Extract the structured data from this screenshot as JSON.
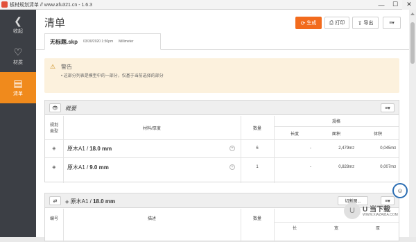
{
  "window": {
    "title": "板材规划清单 // www.afu321.cn - 1.6.3",
    "controls": {
      "minimize": "—",
      "maximize": "☐",
      "close": "✕"
    }
  },
  "sidebar": {
    "items": [
      {
        "label": "收起",
        "icon": "chevron-left-icon",
        "glyph": "❮"
      },
      {
        "label": "材质",
        "icon": "paint-icon",
        "glyph": "♡"
      },
      {
        "label": "清单",
        "icon": "list-icon",
        "glyph": "▤"
      }
    ]
  },
  "header": {
    "title": "清单",
    "buttons": {
      "generate": {
        "label": "生成",
        "glyph": "⟳"
      },
      "print": {
        "label": "打印",
        "glyph": "⎙"
      },
      "export": {
        "label": "导出",
        "glyph": "⇪"
      },
      "menu": {
        "glyph": "≡▾"
      }
    }
  },
  "file": {
    "name": "无标题.skp",
    "date": "03/30/2020 1:50pm",
    "unit": "Millimeter"
  },
  "warning": {
    "title": "警告",
    "text": "• 这部分列表是模型中的一部分，仅基于当前选择的部分"
  },
  "overview": {
    "title": "概要",
    "menu_glyph": "≡▾",
    "columns": {
      "type": "规划\n类型",
      "material": "材料/厚度",
      "qty": "数量",
      "spec": "规格",
      "length": "长度",
      "area": "面积",
      "volume": "体积"
    },
    "rows": [
      {
        "name": "原木A1 / ",
        "thick": "18.0 mm",
        "qty": "6",
        "length": "-",
        "area": "2,479m",
        "volume": "0,045m"
      },
      {
        "name": "原木A1 / ",
        "thick": "9.0 mm",
        "qty": "1",
        "length": "-",
        "area": "0,828m",
        "volume": "0,007m"
      }
    ],
    "area_sup": "2",
    "volume_sup": "3"
  },
  "section2": {
    "title_prefix": "原木A1 / ",
    "title_thick": "18.0 mm",
    "cut_label": "切割图...",
    "columns": {
      "id": "编号",
      "desc": "描述",
      "qty": "数量",
      "length": "长",
      "width": "宽",
      "thick": "厚"
    }
  },
  "watermark": {
    "line1": "U 当下载",
    "line2": "WWW.XIAZAIBA.COM"
  }
}
